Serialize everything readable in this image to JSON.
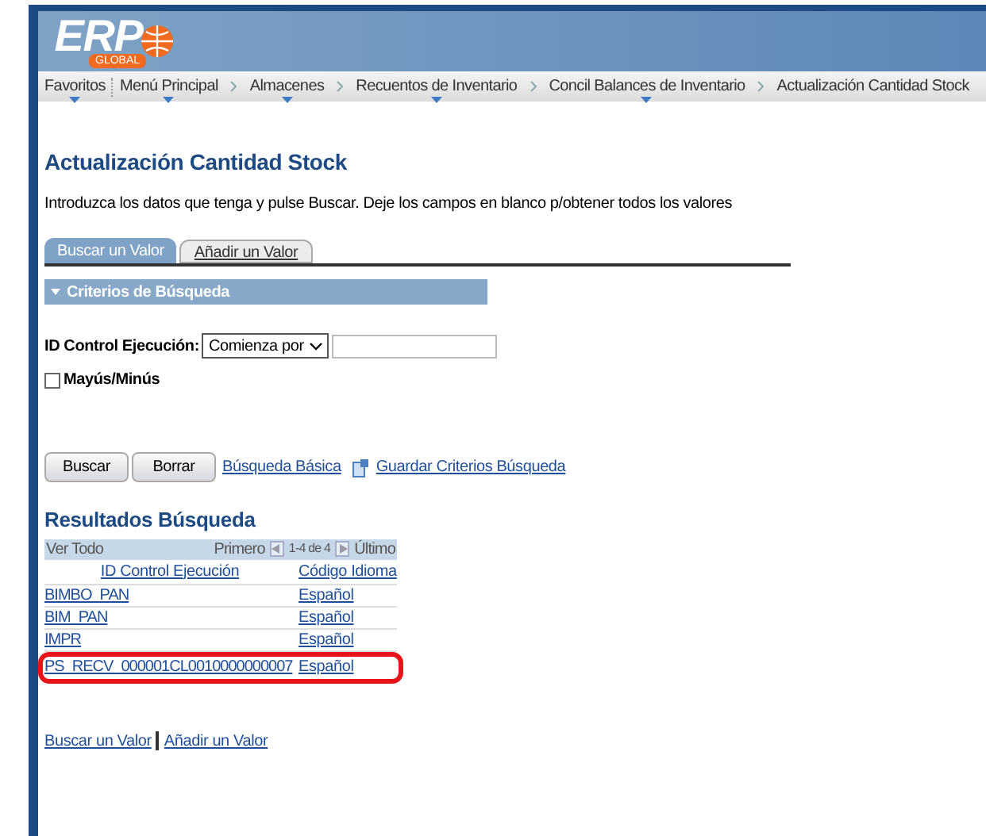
{
  "header": {
    "logo_text": "ERP",
    "logo_sub": "GLOBAL"
  },
  "nav": [
    {
      "label": "Favoritos",
      "dropdown": true
    },
    {
      "label": "Menú Principal",
      "dropdown": true
    },
    {
      "label": "Almacenes",
      "dropdown": true
    },
    {
      "label": "Recuentos de Inventario",
      "dropdown": true
    },
    {
      "label": "Concil Balances de Inventario",
      "dropdown": true
    },
    {
      "label": "Actualización Cantidad Stock",
      "dropdown": false
    }
  ],
  "page_title": "Actualización Cantidad Stock",
  "instructions": "Introduzca los datos que tenga y pulse Buscar. Deje los campos en blanco p/obtener todos los valores",
  "tabs": [
    {
      "label": "Buscar un Valor",
      "selected": true
    },
    {
      "label": "Añadir un Valor",
      "selected": false
    }
  ],
  "criteria": {
    "title": "Criterios de Búsqueda",
    "expanded": true,
    "field_label": "ID Control Ejecución:",
    "operator": "Comienza por",
    "case_label": "Mayús/Minús",
    "case_checked": false
  },
  "buttons": [
    "Buscar",
    "Borrar"
  ],
  "links": [
    "Búsqueda Básica",
    "Guardar Criterios Búsqueda"
  ],
  "results": {
    "title": "Resultados Búsqueda",
    "view_all": "Ver Todo",
    "first": "Primero",
    "range": "1-4 de 4",
    "last": "Último",
    "columns": [
      "ID Control Ejecución",
      "Código Idioma"
    ],
    "rows": [
      {
        "cells": [
          "BIMBO_PAN",
          "Español"
        ],
        "highlighted": false
      },
      {
        "cells": [
          "BIM_PAN",
          "Español"
        ],
        "highlighted": false
      },
      {
        "cells": [
          "IMPR",
          "Español"
        ],
        "highlighted": false
      },
      {
        "cells": [
          "PS_RECV_000001CL0010000000007",
          "Español"
        ],
        "highlighted": true
      }
    ]
  },
  "footer_links": [
    "Buscar un Valor",
    "Añadir un Valor"
  ]
}
